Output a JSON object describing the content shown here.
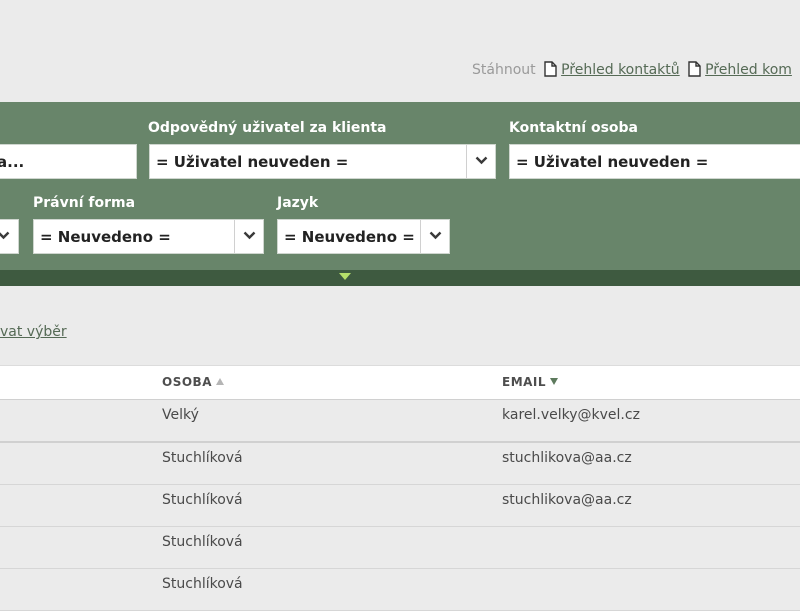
{
  "downloads": {
    "label": "Stáhnout",
    "links": [
      "Přehled kontaktů",
      "Přehled kom"
    ]
  },
  "filters": {
    "search_value": "a...",
    "responsible_user": {
      "label": "Odpovědný uživatel za klienta",
      "value": "= Uživatel neuveden ="
    },
    "contact_person": {
      "label": "Kontaktní osoba",
      "value": "= Uživatel neuveden ="
    },
    "legal_form": {
      "label": "Právní forma",
      "value": "= Neuvedeno ="
    },
    "language": {
      "label": "Jazyk",
      "value": "= Neuvedeno ="
    }
  },
  "reset_link": "vat výběr",
  "table": {
    "columns": [
      "OSOBA",
      "EMAIL"
    ],
    "rows": [
      {
        "person": "Velký",
        "email": "karel.velky@kvel.cz"
      },
      {
        "person": "Stuchlíková",
        "email": "stuchlikova@aa.cz"
      },
      {
        "person": "Stuchlíková",
        "email": "stuchlikova@aa.cz"
      },
      {
        "person": "Stuchlíková",
        "email": ""
      },
      {
        "person": "Stuchlíková",
        "email": ""
      }
    ]
  },
  "colors": {
    "panel": "#68856a",
    "panel_bar": "#3e5a40",
    "toggle_arrow": "#b6e06a",
    "link": "#556a55"
  }
}
